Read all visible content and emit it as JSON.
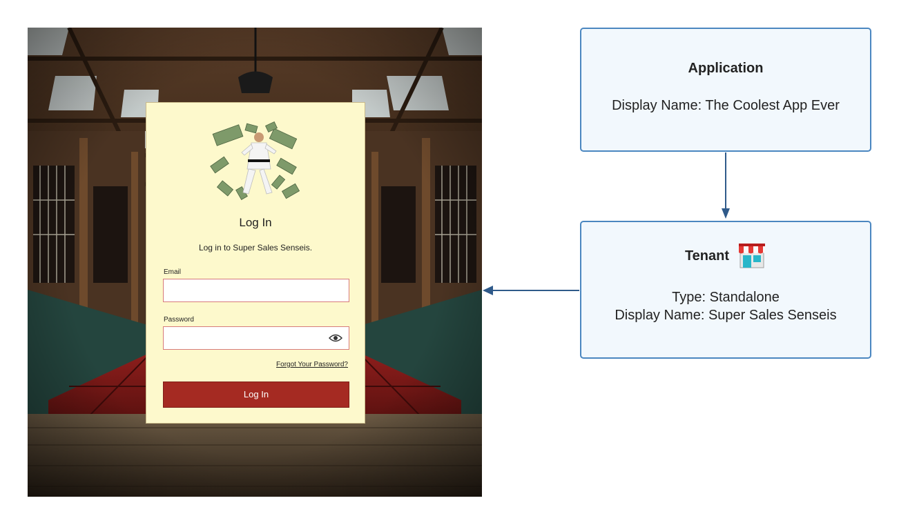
{
  "login": {
    "title": "Log In",
    "subtitle": "Log in to Super Sales Senseis.",
    "email_label": "Email",
    "email_value": "",
    "password_label": "Password",
    "password_value": "",
    "forgot_link": "Forgot Your Password?",
    "submit_label": "Log In",
    "icons": {
      "password_toggle": "eye-icon",
      "hero": "karate-money-illustration"
    }
  },
  "diagram": {
    "application": {
      "title": "Application",
      "display_name": "Display Name: The Coolest App Ever"
    },
    "tenant": {
      "title": "Tenant",
      "icon": "store-icon",
      "type": "Type: Standalone",
      "display_name": "Display Name: Super Sales Senseis"
    },
    "colors": {
      "box_border": "#4a86c0",
      "box_fill": "#f2f8fd",
      "connector": "#2f5a8a",
      "button": "#a52a22",
      "card": "#fdf9cc"
    }
  }
}
